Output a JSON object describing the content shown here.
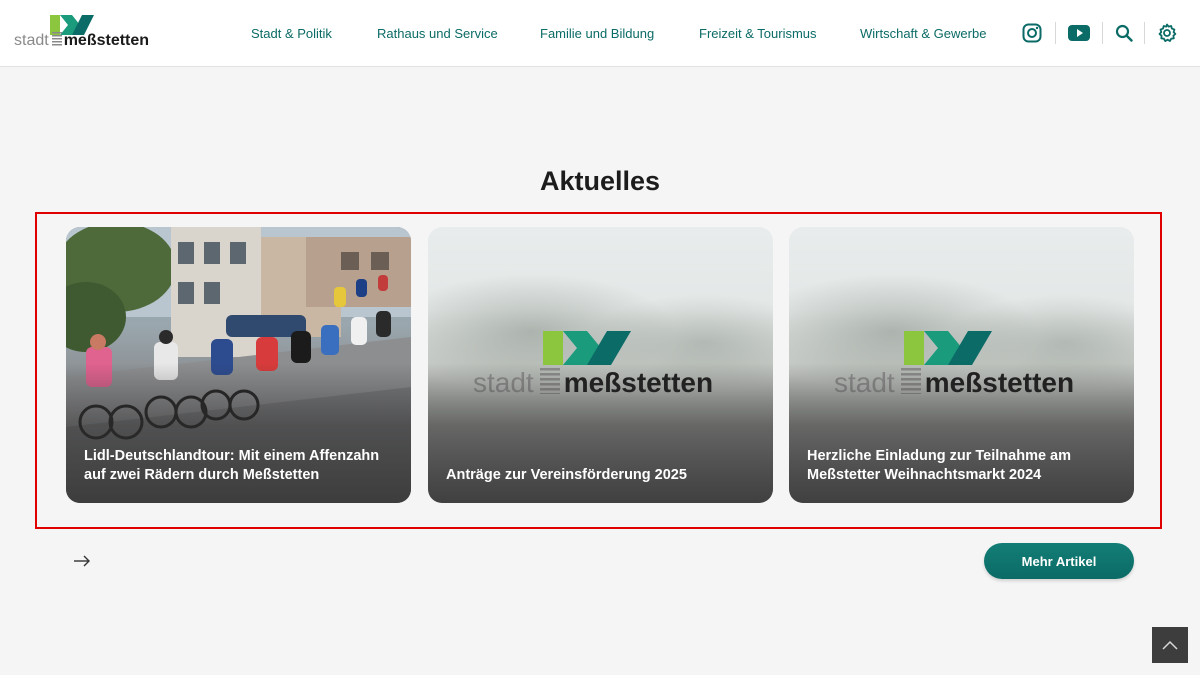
{
  "logo": {
    "light": "stadt",
    "bold": "meßstetten"
  },
  "nav": {
    "items": [
      {
        "label": "Stadt & Politik"
      },
      {
        "label": "Rathaus und Service"
      },
      {
        "label": "Familie und Bildung"
      },
      {
        "label": "Freizeit & Tourismus"
      },
      {
        "label": "Wirtschaft & Gewerbe"
      }
    ]
  },
  "icons": [
    "instagram-icon",
    "youtube-icon",
    "search-icon",
    "gear-icon",
    "arrow-right-icon",
    "chevron-up-icon"
  ],
  "colors": {
    "brand": "#0b6b66",
    "brand_green": "#8cc63f",
    "highlight": "#e00000"
  },
  "section": {
    "title": "Aktuelles"
  },
  "articles": [
    {
      "title": "Lidl-Deutschlandtour: Mit einem Affenzahn auf zwei Rädern durch Meßstetten"
    },
    {
      "title": "Anträge zur Vereinsförderung 2025"
    },
    {
      "title": "Herzliche Einladung zur Teilnahme am Meßstetter Weihnachtsmarkt 2024"
    }
  ],
  "more_button": {
    "label": "Mehr Artikel"
  }
}
